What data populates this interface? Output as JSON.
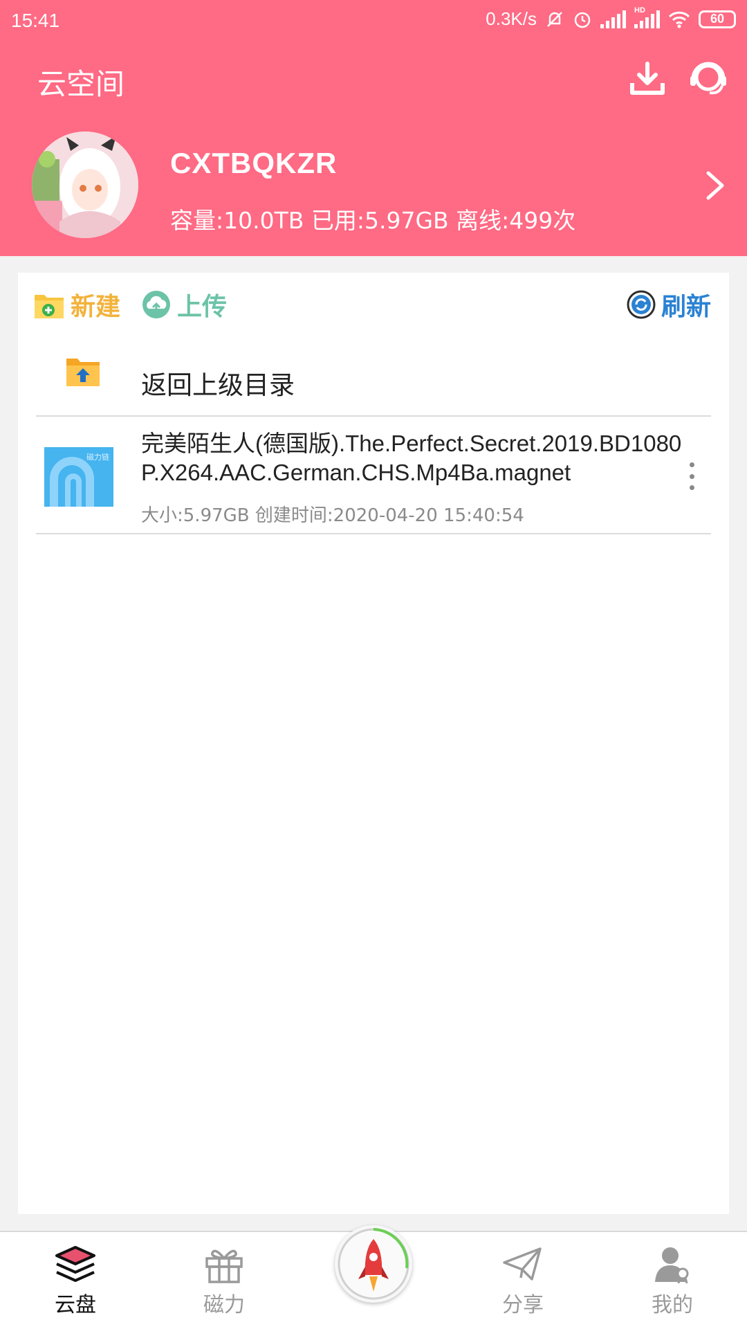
{
  "status_bar": {
    "time": "15:41",
    "net_speed": "0.3K/s",
    "network_label": "HD",
    "battery": "60"
  },
  "header": {
    "title": "云空间",
    "colors": {
      "background": "#ff6a84",
      "text": "#ffffff"
    }
  },
  "profile": {
    "username": "CXTBQKZR",
    "quota": "容量:10.0TB 已用:5.97GB 离线:499次"
  },
  "toolbar": {
    "new_label": "新建",
    "upload_label": "上传",
    "refresh_label": "刷新",
    "colors": {
      "new": "#f3b23b",
      "upload": "#6cc3a7",
      "refresh": "#2b82d3"
    }
  },
  "file_list": {
    "parent_dir_label": "返回上级目录",
    "items": [
      {
        "thumbnail_tag": "磁力链",
        "name": "完美陌生人(德国版).The.Perfect.Secret.2019.BD1080P.X264.AAC.German.CHS.Mp4Ba.magnet",
        "meta": "大小:5.97GB 创建时间:2020-04-20 15:40:54"
      }
    ]
  },
  "bottom_nav": {
    "items": [
      {
        "label": "云盘",
        "icon": "stack-icon",
        "active": true
      },
      {
        "label": "磁力",
        "icon": "gift-icon",
        "active": false
      },
      {
        "label": "",
        "icon": "rocket-icon",
        "active": false
      },
      {
        "label": "分享",
        "icon": "paper-plane-icon",
        "active": false
      },
      {
        "label": "我的",
        "icon": "user-icon",
        "active": false
      }
    ]
  }
}
